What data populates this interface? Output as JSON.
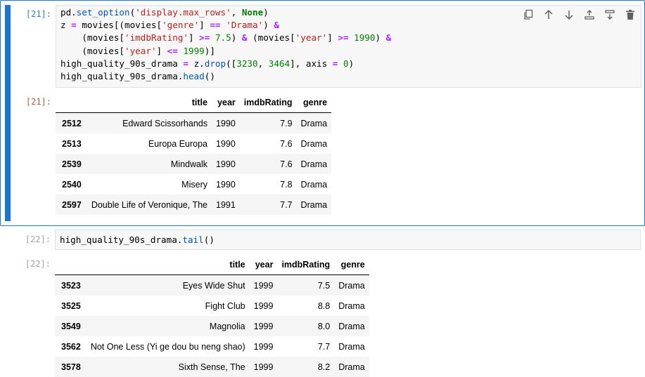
{
  "cells": [
    {
      "prompt_in": "[21]:",
      "code_lines": [
        [
          [
            "pd.",
            "n"
          ],
          [
            "set_option",
            "fn"
          ],
          [
            "(",
            "n"
          ],
          [
            "'display.max_rows'",
            "str"
          ],
          [
            ", ",
            "n"
          ],
          [
            "None",
            "kw"
          ],
          [
            ")",
            "n"
          ]
        ],
        [
          [
            "z ",
            "n"
          ],
          [
            "=",
            "op"
          ],
          [
            " movies[(movies[",
            "n"
          ],
          [
            "'genre'",
            "str"
          ],
          [
            "] ",
            "n"
          ],
          [
            "==",
            "op"
          ],
          [
            " ",
            "n"
          ],
          [
            "'Drama'",
            "str"
          ],
          [
            ") ",
            "n"
          ],
          [
            "&",
            "op"
          ]
        ],
        [
          [
            "    (movies[",
            "n"
          ],
          [
            "'imdbRating'",
            "str"
          ],
          [
            "] ",
            "n"
          ],
          [
            ">=",
            "op"
          ],
          [
            " ",
            "n"
          ],
          [
            "7.5",
            "num"
          ],
          [
            ") ",
            "n"
          ],
          [
            "&",
            "op"
          ],
          [
            " (movies[",
            "n"
          ],
          [
            "'year'",
            "str"
          ],
          [
            "] ",
            "n"
          ],
          [
            ">=",
            "op"
          ],
          [
            " ",
            "n"
          ],
          [
            "1990",
            "num"
          ],
          [
            ") ",
            "n"
          ],
          [
            "&",
            "op"
          ]
        ],
        [
          [
            "    (movies[",
            "n"
          ],
          [
            "'year'",
            "str"
          ],
          [
            "] ",
            "n"
          ],
          [
            "<=",
            "op"
          ],
          [
            " ",
            "n"
          ],
          [
            "1999",
            "num"
          ],
          [
            ")]",
            "n"
          ]
        ],
        [
          [
            "high_quality_90s_drama ",
            "n"
          ],
          [
            "=",
            "op"
          ],
          [
            " z.",
            "n"
          ],
          [
            "drop",
            "fn"
          ],
          [
            "([",
            "n"
          ],
          [
            "3230",
            "num"
          ],
          [
            ", ",
            "n"
          ],
          [
            "3464",
            "num"
          ],
          [
            "], axis ",
            "n"
          ],
          [
            "=",
            "op"
          ],
          [
            " ",
            "n"
          ],
          [
            "0",
            "num"
          ],
          [
            ")",
            "n"
          ]
        ],
        [
          [
            "high_quality_90s_drama.",
            "n"
          ],
          [
            "head",
            "fn"
          ],
          [
            "()",
            "n"
          ]
        ]
      ],
      "prompt_out": "[21]:",
      "table": {
        "columns": [
          "title",
          "year",
          "imdbRating",
          "genre"
        ],
        "rows": [
          {
            "index": "2512",
            "title": "Edward Scissorhands",
            "year": "1990",
            "imdbRating": "7.9",
            "genre": "Drama"
          },
          {
            "index": "2513",
            "title": "Europa Europa",
            "year": "1990",
            "imdbRating": "7.6",
            "genre": "Drama"
          },
          {
            "index": "2539",
            "title": "Mindwalk",
            "year": "1990",
            "imdbRating": "7.6",
            "genre": "Drama"
          },
          {
            "index": "2540",
            "title": "Misery",
            "year": "1990",
            "imdbRating": "7.8",
            "genre": "Drama"
          },
          {
            "index": "2597",
            "title": "Double Life of Veronique, The",
            "year": "1991",
            "imdbRating": "7.7",
            "genre": "Drama"
          }
        ]
      }
    },
    {
      "prompt_in": "[22]:",
      "code_lines": [
        [
          [
            "high_quality_90s_drama.",
            "n"
          ],
          [
            "tail",
            "fn"
          ],
          [
            "()",
            "n"
          ]
        ]
      ],
      "prompt_out": "[22]:",
      "table": {
        "columns": [
          "title",
          "year",
          "imdbRating",
          "genre"
        ],
        "rows": [
          {
            "index": "3523",
            "title": "Eyes Wide Shut",
            "year": "1999",
            "imdbRating": "7.5",
            "genre": "Drama"
          },
          {
            "index": "3525",
            "title": "Fight Club",
            "year": "1999",
            "imdbRating": "8.8",
            "genre": "Drama"
          },
          {
            "index": "3549",
            "title": "Magnolia",
            "year": "1999",
            "imdbRating": "8.0",
            "genre": "Drama"
          },
          {
            "index": "3562",
            "title": "Not One Less (Yi ge dou bu neng shao)",
            "year": "1999",
            "imdbRating": "7.7",
            "genre": "Drama"
          },
          {
            "index": "3578",
            "title": "Sixth Sense, The",
            "year": "1999",
            "imdbRating": "8.2",
            "genre": "Drama"
          }
        ]
      }
    }
  ],
  "toolbar": {
    "icons": [
      "duplicate-icon",
      "move-up-icon",
      "move-down-icon",
      "insert-above-icon",
      "insert-below-icon",
      "delete-icon"
    ]
  }
}
